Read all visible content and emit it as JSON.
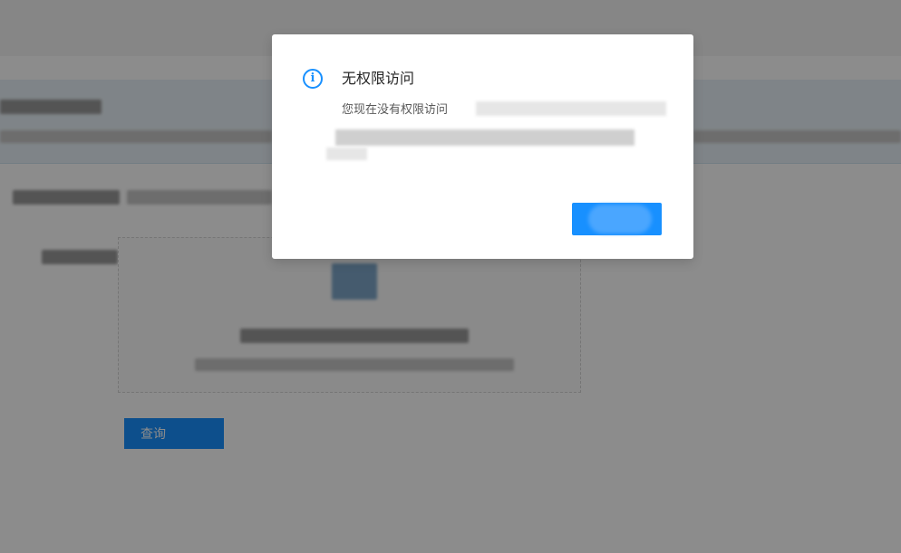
{
  "background_page": {
    "query_button_label": "查询"
  },
  "dialog": {
    "title": "无权限访问",
    "message": "您现在没有权限访问",
    "ok_button_label": "",
    "icon": "info-circle-icon",
    "accent_color": "#1890ff"
  }
}
